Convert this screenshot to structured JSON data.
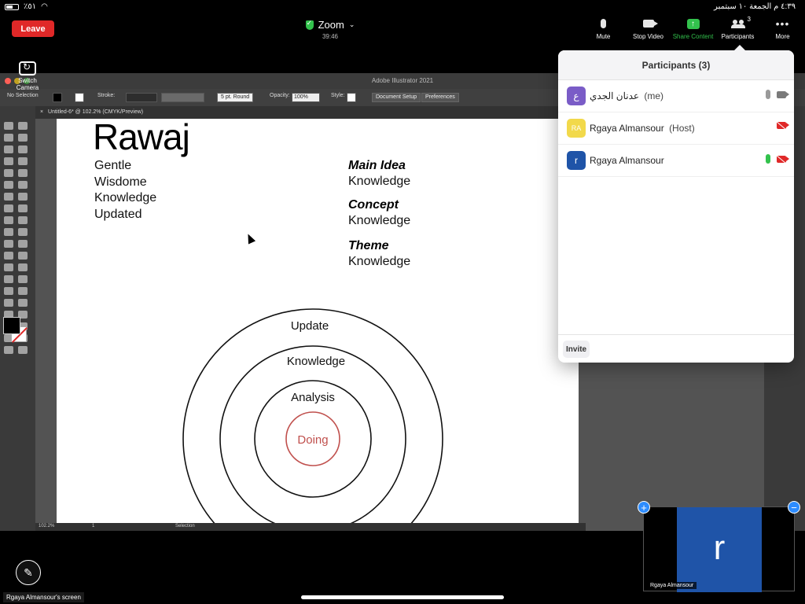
{
  "status_bar": {
    "battery": "٪٥١",
    "datetime": "٤:٣٩ م  الجمعة ١٠ سبتمبر"
  },
  "top_bar": {
    "leave_label": "Leave",
    "app_title": "Zoom",
    "timer": "39:46",
    "tools": {
      "mute": "Mute",
      "stop_video": "Stop Video",
      "share_content": "Share Content",
      "participants": "Participants",
      "participants_count": "3",
      "more": "More"
    }
  },
  "switch_camera": {
    "label": "Switch Camera"
  },
  "illustrator": {
    "window_title": "Adobe Illustrator 2021",
    "selection_label": "No Selection",
    "stroke_label": "Stroke:",
    "brush_label": "5 pt. Round",
    "opacity_label": "Opacity:",
    "opacity_value": "100%",
    "style_label": "Style:",
    "document_setup": "Document Setup",
    "preferences": "Preferences",
    "tab_title": "Untitled-6* @ 102.2% (CMYK/Preview)",
    "zoom_level": "102.2%",
    "page_number": "1",
    "status_tool": "Selection"
  },
  "artboard": {
    "title": "Rawaj",
    "list": [
      "Gentle",
      "Wisdome",
      "Knowledge",
      "Updated"
    ],
    "pairs": [
      {
        "heading": "Main Idea",
        "value": "Knowledge"
      },
      {
        "heading": "Concept",
        "value": "Knowledge"
      },
      {
        "heading": "Theme",
        "value": "Knowledge"
      }
    ],
    "rings": {
      "outer": "Update",
      "middle": "Knowledge",
      "inner": "Analysis",
      "core": "Doing"
    },
    "core_color": "#c0504d"
  },
  "participants_panel": {
    "title": "Participants (3)",
    "participants": [
      {
        "initials": "ع",
        "name": "عدنان الجدي",
        "role": "(me)",
        "avatar_color": "#7a5cc7",
        "mic": "muted",
        "video": "on"
      },
      {
        "initials": "RA",
        "name": "Rgaya Almansour",
        "role": "(Host)",
        "avatar_color": "#f2d94b",
        "mic": "none",
        "video": "off"
      },
      {
        "initials": "r",
        "name": "Rgaya Almansour",
        "role": "",
        "avatar_color": "#1f54a8",
        "mic": "active",
        "video": "off"
      }
    ],
    "invite_label": "Invite"
  },
  "bottom": {
    "screen_label": "Rgaya Almansour's screen",
    "thumbnail_initial": "r",
    "thumbnail_name": "Rgaya Almansour"
  },
  "colors": {
    "leave": "#e02828",
    "share": "#33c24d",
    "accent": "#2d8cff"
  }
}
